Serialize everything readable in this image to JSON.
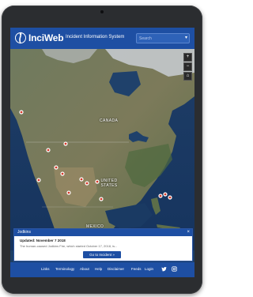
{
  "header": {
    "brand": "InciWeb",
    "subtitle": "Incident Information System",
    "search_placeholder": "Search"
  },
  "map": {
    "labels": {
      "canada": "CANADA",
      "united_states": "UNITED STATES",
      "mexico": "MEXICO"
    },
    "controls": [
      "plus-icon",
      "minus-icon",
      "home-icon"
    ]
  },
  "panel": {
    "title": "Jodkins",
    "updated": "Updated: November 7 2018",
    "text": "The human-caused Jodkins Fire, which started October 17, 2018, is...",
    "button": "Go to Incident »"
  },
  "footer": {
    "links": [
      "Links",
      "Terminology",
      "About",
      "Help",
      "Disclaimer",
      "Feeds",
      "Login"
    ],
    "social": [
      "twitter-icon",
      "instagram-icon"
    ]
  },
  "colors": {
    "brand_blue": "#1e4fa3",
    "device_frame": "#2b2d30"
  }
}
